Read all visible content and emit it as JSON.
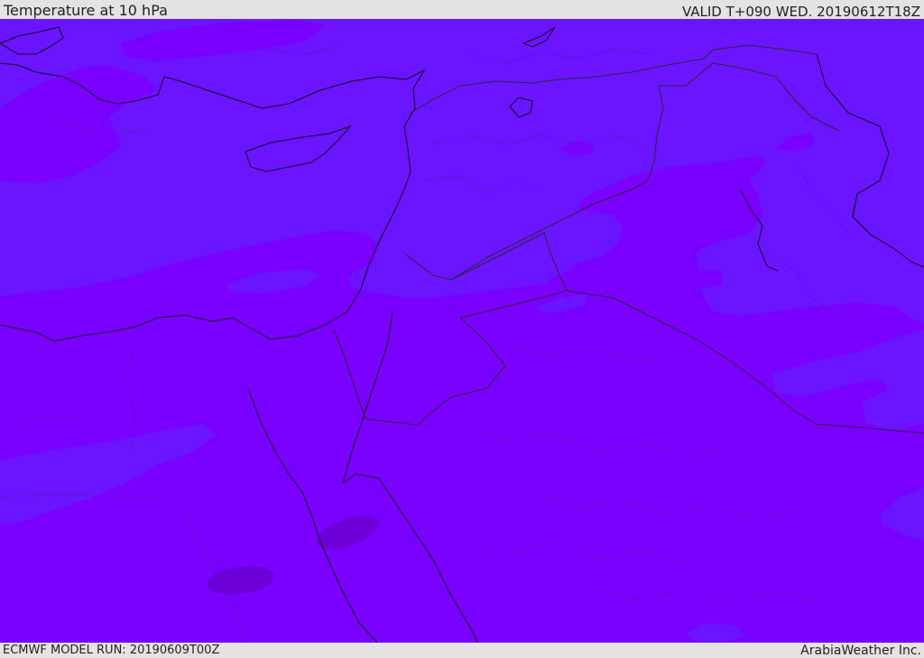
{
  "header": {
    "title": "Temperature at 10 hPa",
    "valid_time": "VALID T+090 WED. 20190612T18Z"
  },
  "footer": {
    "model_run": "ECMWF MODEL RUN: 20190609T00Z",
    "credit": "ArabiaWeather Inc."
  },
  "map": {
    "region": "Eastern Mediterranean and Middle East",
    "field": "temperature",
    "fill_colors": {
      "background": "#7a00ff",
      "cooler_band": "#6a14ff",
      "warmer_patch": "#8a00f0",
      "darkest_patch": "#6a00c8"
    },
    "line_colors": {
      "coastline": "#111111",
      "border": "#2a2a2a"
    }
  }
}
